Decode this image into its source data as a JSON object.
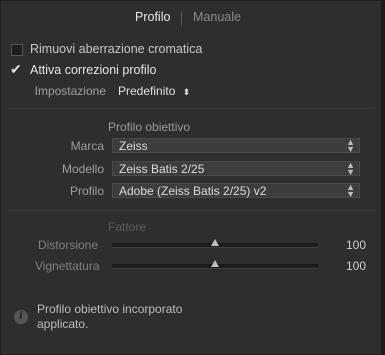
{
  "tabs": {
    "active": "Profilo",
    "inactive": "Manuale"
  },
  "options": {
    "remove_ca": {
      "label": "Rimuovi aberrazione cromatica",
      "checked": false
    },
    "enable_profile": {
      "label": "Attiva correzioni profilo",
      "checked": true
    }
  },
  "setup": {
    "label": "Impostazione",
    "value": "Predefinito"
  },
  "lens_profile": {
    "title": "Profilo obiettivo",
    "make_label": "Marca",
    "make_value": "Zeiss",
    "model_label": "Modello",
    "model_value": "Zeiss Batis 2/25",
    "profile_label": "Profilo",
    "profile_value": "Adobe (Zeiss Batis 2/25) v2"
  },
  "amount": {
    "title": "Fattore",
    "distortion_label": "Distorsione",
    "distortion_value": "100",
    "vignetting_label": "Vignettatura",
    "vignetting_value": "100"
  },
  "info": {
    "text": "Profilo obiettivo incorporato applicato."
  },
  "icons": {
    "info": "info-icon",
    "check": "checkmark-icon",
    "dropdown": "updown-arrows-icon"
  }
}
